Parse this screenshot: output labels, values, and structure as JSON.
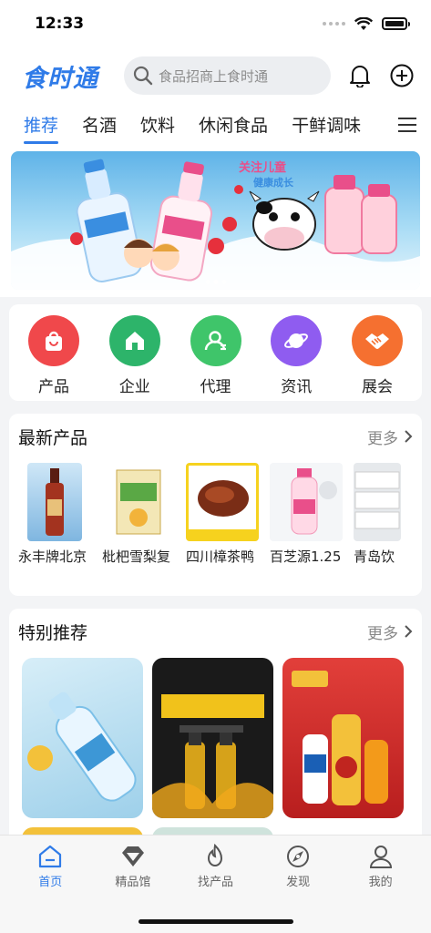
{
  "status_bar": {
    "time": "12:33"
  },
  "header": {
    "logo": "食时通",
    "search_placeholder": "食品招商上食时通"
  },
  "categories": [
    "推荐",
    "名酒",
    "饮料",
    "休闲食品",
    "干鲜调味"
  ],
  "quick_nav": [
    {
      "label": "产品",
      "color": "#f0484b",
      "icon": "bag-icon"
    },
    {
      "label": "企业",
      "color": "#2db46a",
      "icon": "home-icon"
    },
    {
      "label": "代理",
      "color": "#3fc56a",
      "icon": "person-icon"
    },
    {
      "label": "资讯",
      "color": "#8f5cf0",
      "icon": "planet-icon"
    },
    {
      "label": "展会",
      "color": "#f57030",
      "icon": "handshake-icon"
    }
  ],
  "latest_products": {
    "title": "最新产品",
    "more_label": "更多",
    "items": [
      {
        "name": "永丰牌北京"
      },
      {
        "name": "枇杷雪梨复"
      },
      {
        "name": "四川樟茶鸭"
      },
      {
        "name": "百芝源1.25"
      },
      {
        "name": "青岛饮"
      }
    ]
  },
  "special_recommend": {
    "title": "特别推荐",
    "more_label": "更多"
  },
  "tabbar": [
    {
      "label": "首页",
      "icon": "home-outline-icon",
      "active": true
    },
    {
      "label": "精品馆",
      "icon": "diamond-icon",
      "active": false
    },
    {
      "label": "找产品",
      "icon": "flame-icon",
      "active": false
    },
    {
      "label": "发现",
      "icon": "compass-icon",
      "active": false
    },
    {
      "label": "我的",
      "icon": "user-icon",
      "active": false
    }
  ],
  "colors": {
    "accent": "#2f7be8"
  }
}
